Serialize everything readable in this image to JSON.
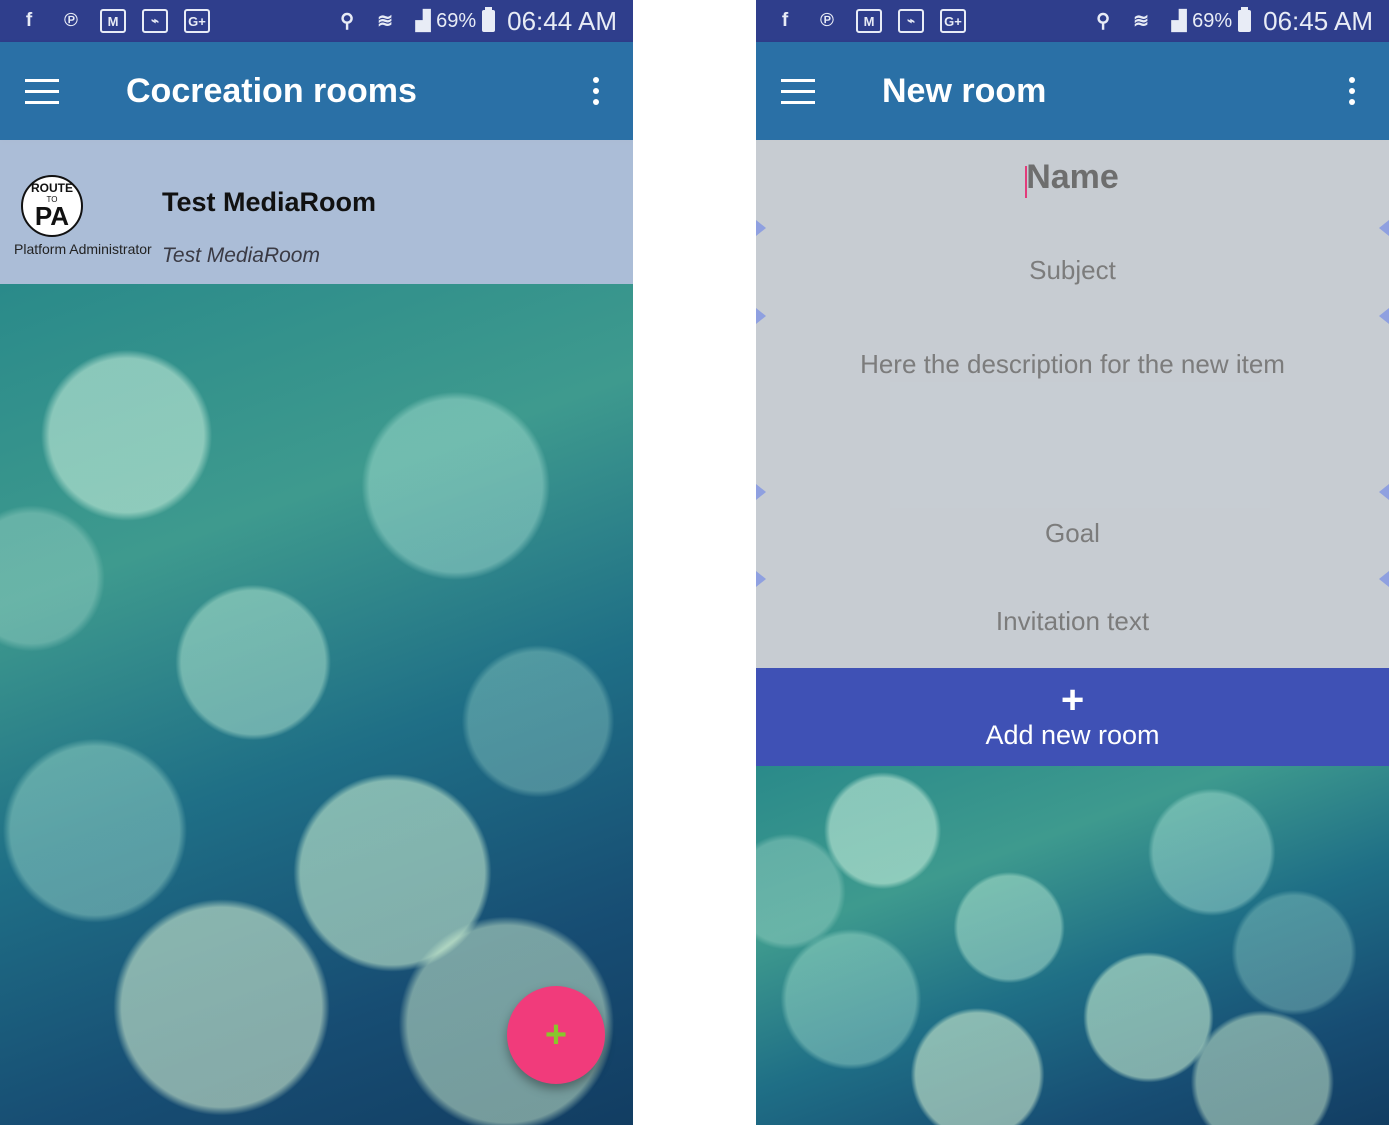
{
  "left_screen": {
    "status_bar": {
      "notification_icons": [
        "facebook-icon",
        "pinterest-icon",
        "gmail-icon",
        "gallery-icon",
        "google-plus-icon"
      ],
      "battery": "69%",
      "time": "06:44 AM"
    },
    "app_bar": {
      "title": "Cocreation rooms"
    },
    "rooms": [
      {
        "title": "Test MediaRoom",
        "subtitle": "Test MediaRoom",
        "owner": "Platform Administrator",
        "logo": {
          "line1": "ROUTE",
          "line2": "TO",
          "line3": "PA"
        }
      }
    ],
    "fab": {
      "label": "+",
      "color": "#f13b7b",
      "icon_color": "#8ac62b"
    }
  },
  "right_screen": {
    "status_bar": {
      "notification_icons": [
        "facebook-icon",
        "pinterest-icon",
        "gmail-icon",
        "gallery-icon",
        "google-plus-icon"
      ],
      "battery": "69%",
      "time": "06:45 AM"
    },
    "app_bar": {
      "title": "New room"
    },
    "form": {
      "name_placeholder": "Name",
      "subject_placeholder": "Subject",
      "description_placeholder": "Here the description for the new item",
      "goal_placeholder": "Goal",
      "invitation_placeholder": "Invitation text"
    },
    "add_button": {
      "icon": "+",
      "label": "Add new room",
      "color": "#3f51b5"
    }
  },
  "colors": {
    "status_bar": "#2f3e8c",
    "app_bar": "#2a70a6",
    "accent": "#f13b7b"
  }
}
